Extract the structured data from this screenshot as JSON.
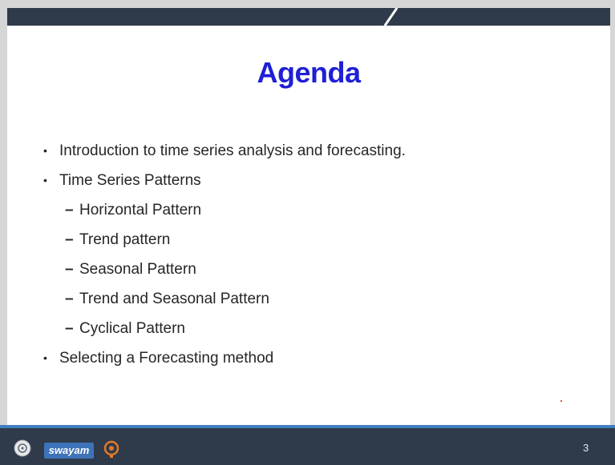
{
  "slide": {
    "title": "Agenda",
    "items": [
      {
        "text": "Introduction to time series analysis and forecasting."
      },
      {
        "text": "Time Series Patterns",
        "subitems": [
          "Horizontal Pattern",
          "Trend pattern",
          "Seasonal Pattern",
          "Trend and Seasonal Pattern",
          "Cyclical Pattern"
        ]
      },
      {
        "text": "Selecting a Forecasting method"
      }
    ],
    "bullet_glyph": "•",
    "dash_glyph": "–"
  },
  "footer": {
    "logo_text": "swayam",
    "page_number": "3"
  },
  "colors": {
    "title": "#1f1fd6",
    "top_bar": "#2f3a4a",
    "bottom_bar": "#2f3a4a",
    "accent": "#3f7fc2"
  },
  "icons": {
    "emblem": "emblem-icon",
    "nptel": "nptel-logo-icon"
  }
}
